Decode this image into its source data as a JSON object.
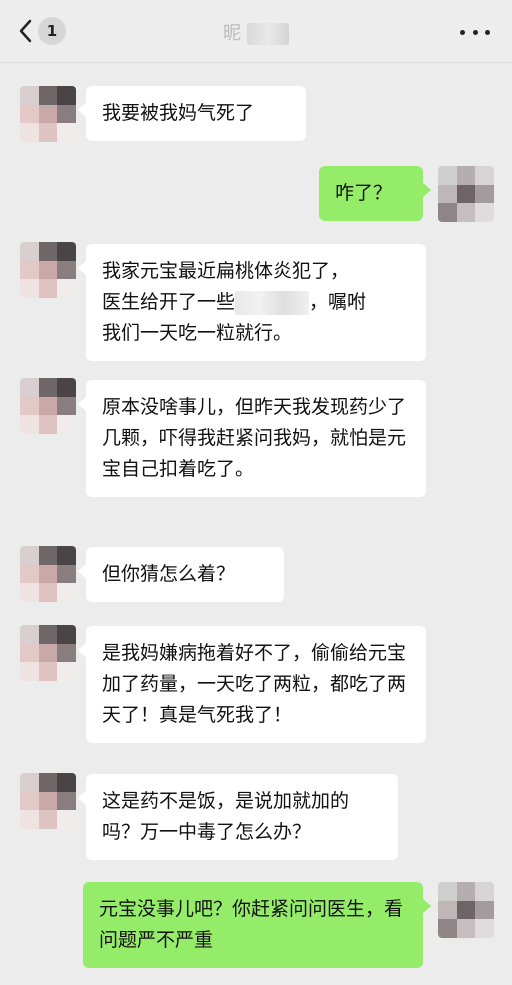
{
  "header": {
    "badge": "1",
    "title": "昵",
    "back_icon": "chevron-left-icon",
    "more_icon": "ellipsis-icon"
  },
  "messages": [
    {
      "side": "left",
      "text": "我要被我妈气死了"
    },
    {
      "side": "right",
      "text": "咋了？"
    },
    {
      "side": "left",
      "line1": "我家元宝最近扁桃体炎犯了，",
      "line2_a": "医生给开了一些",
      "line2_b": "，嘱咐",
      "line3": "我们一天吃一粒就行。"
    },
    {
      "side": "left",
      "text": "原本没啥事儿，但昨天我发现药少了几颗，吓得我赶紧问我妈，就怕是元宝自己扣着吃了。"
    },
    {
      "side": "left",
      "text": "但你猜怎么着？"
    },
    {
      "side": "left",
      "text": "是我妈嫌病拖着好不了，偷偷给元宝加了药量，一天吃了两粒，都吃了两天了！真是气死我了！"
    },
    {
      "side": "left",
      "text": "这是药不是饭，是说加就加的吗？万一中毒了怎么办？"
    },
    {
      "side": "right",
      "text": "元宝没事儿吧？你赶紧问问医生，看问题严不严重"
    }
  ],
  "colors": {
    "background": "#ececec",
    "bubble_left": "#ffffff",
    "bubble_right": "#95ec69"
  }
}
